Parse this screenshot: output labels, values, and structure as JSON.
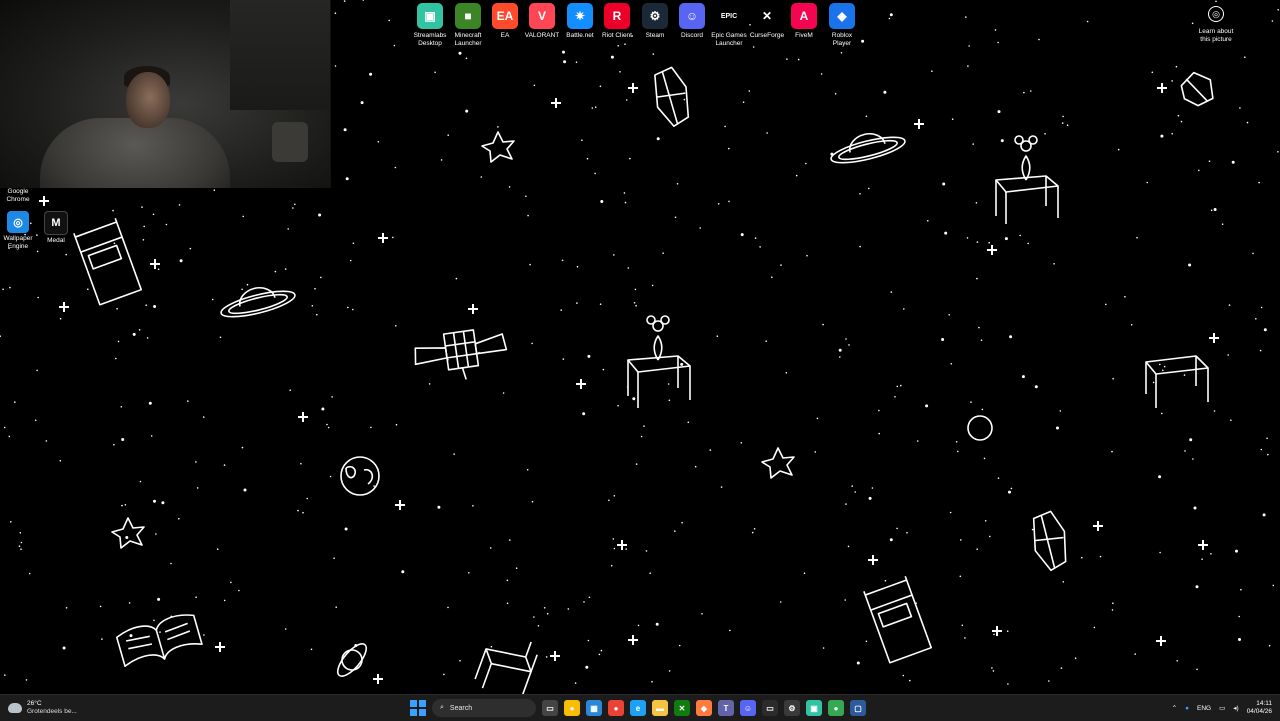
{
  "desktop": {
    "wallpaper": "space-doodle-wallpaper",
    "top_icons": [
      {
        "label": "Streamlabs Desktop",
        "icon": "streamlabs-icon",
        "color": "#31c3a2",
        "glyph": "▣"
      },
      {
        "label": "Minecraft Launcher",
        "icon": "minecraft-icon",
        "color": "#3c8527",
        "glyph": "■"
      },
      {
        "label": "EA",
        "icon": "ea-icon",
        "color": "#ff4b2b",
        "glyph": "EA"
      },
      {
        "label": "VALORANT",
        "icon": "valorant-icon",
        "color": "#ff4655",
        "glyph": "V"
      },
      {
        "label": "Battle.net",
        "icon": "battlenet-icon",
        "color": "#148eff",
        "glyph": "✷"
      },
      {
        "label": "Riot Client",
        "icon": "riot-icon",
        "color": "#eb0029",
        "glyph": "R"
      },
      {
        "label": "Steam",
        "icon": "steam-icon",
        "color": "#1b2838",
        "glyph": "⚙"
      },
      {
        "label": "Discord",
        "icon": "discord-icon",
        "color": "#5865f2",
        "glyph": "☺"
      },
      {
        "label": "Epic Games Launcher",
        "icon": "epic-icon",
        "color": "#000000",
        "glyph": "EPIC"
      },
      {
        "label": "CurseForge",
        "icon": "curseforge-icon",
        "color": "#000000",
        "glyph": "✕"
      },
      {
        "label": "FiveM",
        "icon": "fivem-icon",
        "color": "#f40552",
        "glyph": "A"
      },
      {
        "label": "Roblox Player",
        "icon": "roblox-icon",
        "color": "#1a73e8",
        "glyph": "◆"
      }
    ],
    "left_icons": [
      {
        "label": "Google Chrome",
        "icon": "chrome-icon"
      },
      {
        "label": "Wallpaper Engine",
        "icon": "wallpaper-engine-icon",
        "color": "#1e88e5",
        "glyph": "◎"
      },
      {
        "label": "Medal",
        "icon": "medal-icon",
        "color": "#111111",
        "glyph": "M"
      }
    ],
    "learn_about": {
      "label": "Learn about this picture",
      "icon": "camera-icon"
    }
  },
  "taskbar": {
    "weather": {
      "temp": "26°C",
      "desc": "Grotendeels be...",
      "icon": "cloud-icon"
    },
    "search_placeholder": "Search",
    "apps": [
      {
        "name": "task-view-icon",
        "color": "#444444",
        "glyph": "▭"
      },
      {
        "name": "chrome-taskbar-icon",
        "color": "#fbbc04",
        "glyph": "●"
      },
      {
        "name": "store-icon",
        "color": "#2b88d8",
        "glyph": "▦"
      },
      {
        "name": "chrome-alt-icon",
        "color": "#ea4335",
        "glyph": "●"
      },
      {
        "name": "edge-icon",
        "color": "#1da1f2",
        "glyph": "e"
      },
      {
        "name": "file-explorer-icon",
        "color": "#f5c242",
        "glyph": "▬"
      },
      {
        "name": "xbox-icon",
        "color": "#107c10",
        "glyph": "✕"
      },
      {
        "name": "app-orange-icon",
        "color": "#ff7a3d",
        "glyph": "◆"
      },
      {
        "name": "teams-icon",
        "color": "#6264a7",
        "glyph": "T"
      },
      {
        "name": "discord-taskbar-icon",
        "color": "#5865f2",
        "glyph": "☺"
      },
      {
        "name": "terminal-icon",
        "color": "#2b2b2b",
        "glyph": "▭"
      },
      {
        "name": "settings-icon",
        "color": "#3a3a3a",
        "glyph": "⚙"
      },
      {
        "name": "streamlabs-taskbar-icon",
        "color": "#31c3a2",
        "glyph": "▣"
      },
      {
        "name": "chrome-taskbar2-icon",
        "color": "#34a853",
        "glyph": "●"
      },
      {
        "name": "active-window-icon",
        "color": "#2d5a9a",
        "glyph": "▢"
      }
    ],
    "tray": {
      "lang": "ENG",
      "time": "14:11",
      "date": "04/04/26"
    }
  }
}
